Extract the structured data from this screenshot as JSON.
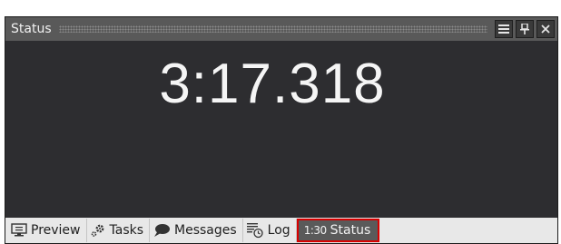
{
  "panel": {
    "title": "Status",
    "controls": [
      "menu-icon",
      "pin-icon",
      "close-icon"
    ]
  },
  "display": {
    "time": "3:17.318"
  },
  "tabs": [
    {
      "label": "Preview",
      "icon": "monitor-icon"
    },
    {
      "label": "Tasks",
      "icon": "gears-icon"
    },
    {
      "label": "Messages",
      "icon": "speech-bubble-icon"
    },
    {
      "label": "Log",
      "icon": "log-clock-icon"
    },
    {
      "label": "Status",
      "icon": "status-time-icon",
      "badge": "1:30",
      "active": true
    }
  ],
  "colors": {
    "panel_bg": "#2d2d30",
    "titlebar_bg": "#595959",
    "tabbar_bg": "#e8e8e8",
    "active_tab_bg": "#5a5a5a",
    "active_tab_border": "#d80000",
    "time_text": "#f5f5f5"
  }
}
